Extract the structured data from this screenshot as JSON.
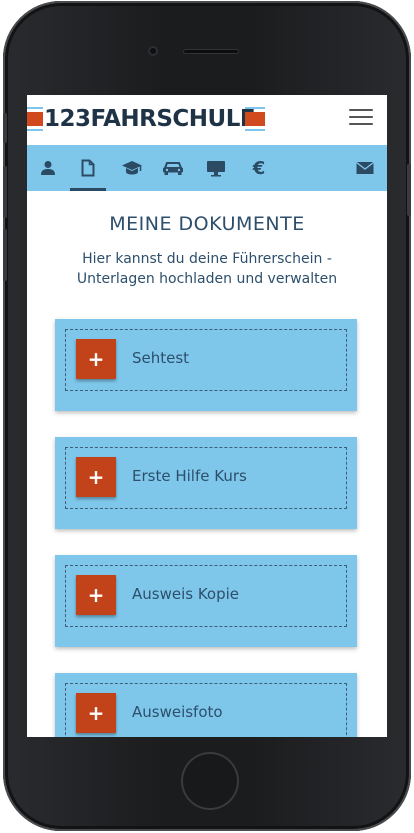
{
  "header": {
    "logo_text": "123FAHRSCHULE"
  },
  "nav": {
    "items": [
      {
        "icon": "user-icon"
      },
      {
        "icon": "document-icon",
        "active": true
      },
      {
        "icon": "graduation-cap-icon"
      },
      {
        "icon": "car-icon"
      },
      {
        "icon": "monitor-icon"
      },
      {
        "icon": "euro-icon",
        "label": "€"
      },
      {
        "icon": "mail-icon"
      }
    ]
  },
  "page": {
    "title": "MEINE DOKUMENTE",
    "subtitle": "Hier kannst du deine Führerschein - Unterlagen hochladen und verwalten"
  },
  "documents": [
    {
      "label": "Sehtest",
      "button": "+"
    },
    {
      "label": "Erste Hilfe Kurs",
      "button": "+"
    },
    {
      "label": "Ausweis Kopie",
      "button": "+"
    },
    {
      "label": "Ausweisfoto",
      "button": "+"
    }
  ],
  "colors": {
    "accent_blue": "#7ec7ea",
    "button_red": "#c2421a",
    "text_dark": "#2d4f6b"
  }
}
